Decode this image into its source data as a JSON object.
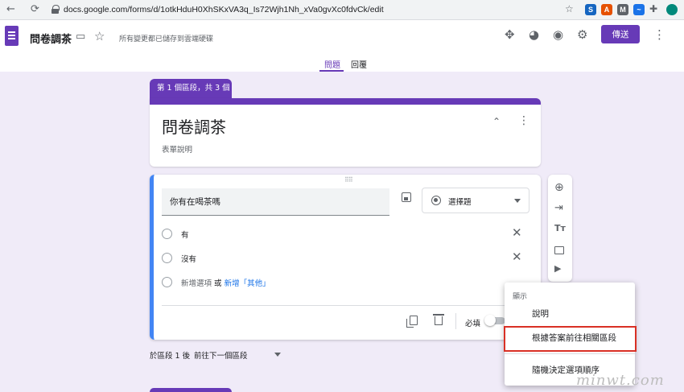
{
  "browser": {
    "url": "docs.google.com/forms/d/1otkHduH0XhSKxVA3q_Is72Wjh1Nh_xVa0gvXc0fdvCk/edit",
    "extensions": [
      {
        "label": "S",
        "color": "#1565c0"
      },
      {
        "label": "A",
        "color": "#e65100"
      },
      {
        "label": "M",
        "color": "#5f6368"
      },
      {
        "label": "~",
        "color": "#1a73e8"
      }
    ]
  },
  "header": {
    "title": "問卷調茶",
    "saved_status": "所有變更都已儲存到雲端硬碟",
    "send_label": "傳送",
    "tabs": [
      {
        "label": "問題",
        "active": true
      },
      {
        "label": "回覆",
        "active": false
      }
    ],
    "accent_color": "#673ab7"
  },
  "section": {
    "tag": "第 1 個區段，共 3 個",
    "title": "問卷調茶",
    "description": "表單說明"
  },
  "question": {
    "text": "你有在喝茶嗎",
    "type_label": "選擇題",
    "options": [
      "有",
      "沒有"
    ],
    "add_option": "新增選項",
    "or_text": "或",
    "add_other": "新增「其他」",
    "required_label": "必填"
  },
  "side_toolbar": {
    "icons": [
      "add-question-icon",
      "import-icon",
      "title-text-icon",
      "image-icon",
      "video-icon"
    ]
  },
  "menu": {
    "header": "顯示",
    "items": [
      "說明",
      "根據答案前往相關區段",
      "隨機決定選項順序"
    ],
    "highlighted_index": 1
  },
  "footer": {
    "after_section": "於區段 1 後",
    "goto_label": "前往下一個區段"
  },
  "watermark": "minwt.com"
}
